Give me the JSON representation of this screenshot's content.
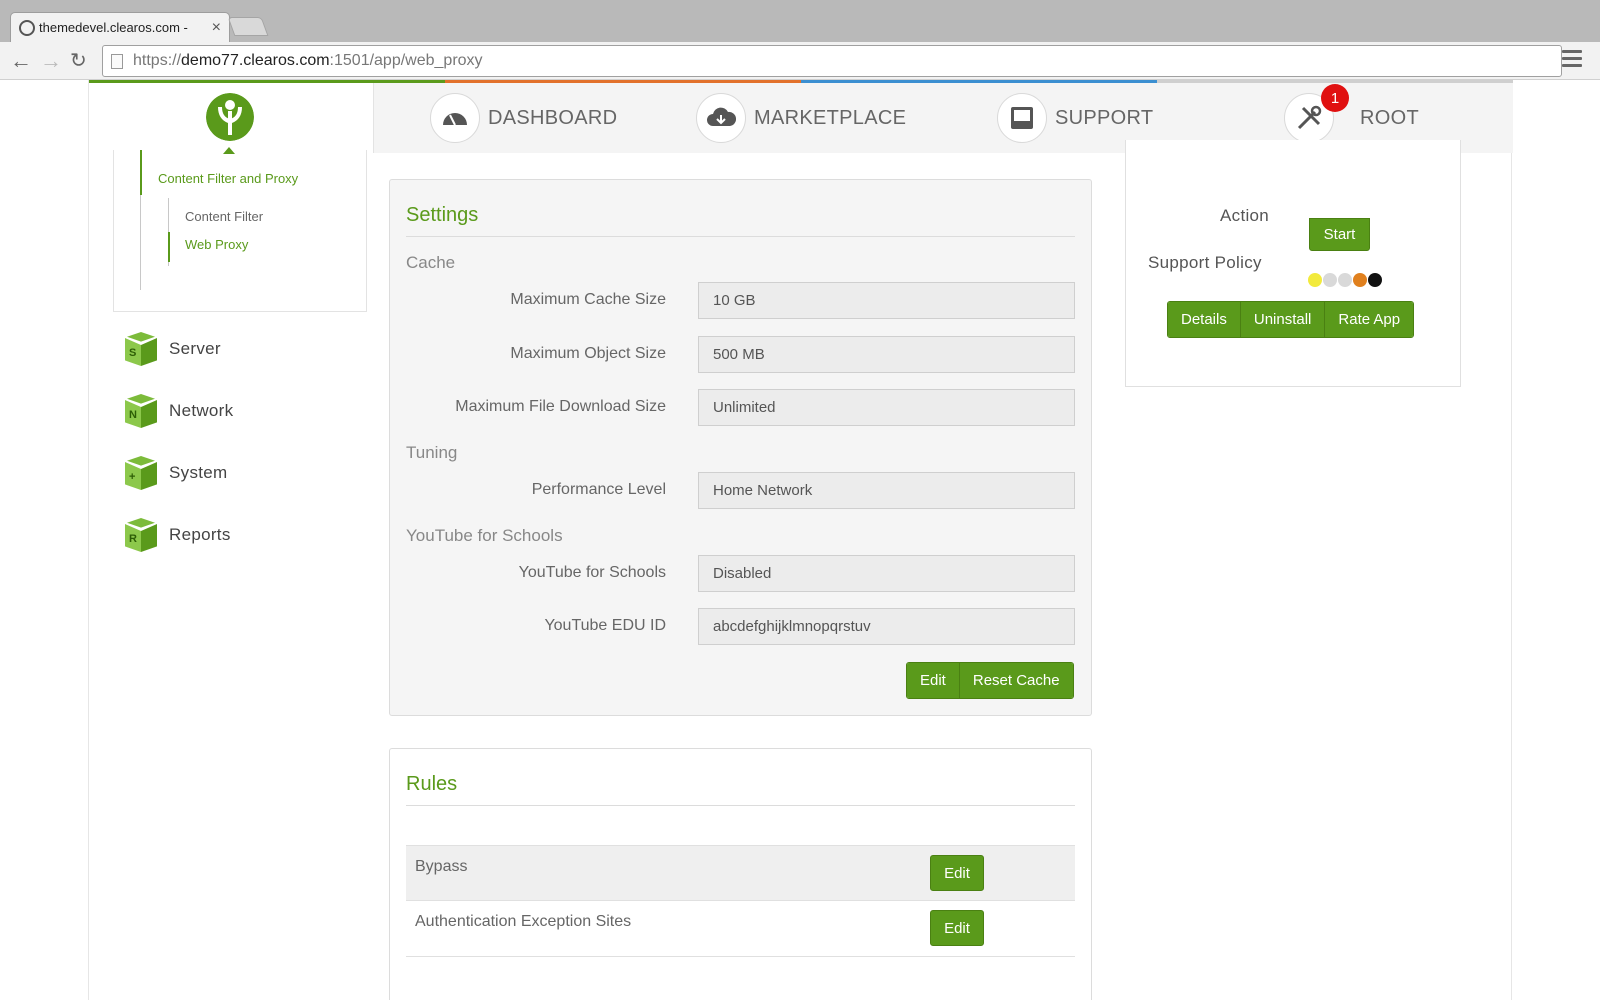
{
  "browser": {
    "tab_title": "themedevel.clearos.com -",
    "url_scheme": "https://",
    "url_host": "demo77.clearos.com",
    "url_rest": ":1501/app/web_proxy"
  },
  "topnav": {
    "dashboard": "DASHBOARD",
    "marketplace": "MARKETPLACE",
    "support": "SUPPORT",
    "root": "ROOT",
    "root_badge": "1"
  },
  "sidebar": {
    "group": "Content Filter and Proxy",
    "sub_items": [
      "Content Filter",
      "Web Proxy"
    ],
    "categories": [
      {
        "label": "Server",
        "letter": "S"
      },
      {
        "label": "Network",
        "letter": "N"
      },
      {
        "label": "System",
        "letter": "+"
      },
      {
        "label": "Reports",
        "letter": "R"
      }
    ]
  },
  "settings": {
    "title": "Settings",
    "cache_heading": "Cache",
    "tuning_heading": "Tuning",
    "youtube_heading": "YouTube for Schools",
    "fields": [
      {
        "label": "Maximum Cache Size",
        "value": "10 GB"
      },
      {
        "label": "Maximum Object Size",
        "value": "500 MB"
      },
      {
        "label": "Maximum File Download Size",
        "value": "Unlimited"
      },
      {
        "label": "Performance Level",
        "value": "Home Network"
      },
      {
        "label": "YouTube for Schools",
        "value": "Disabled"
      },
      {
        "label": "YouTube EDU ID",
        "value": "abcdefghijklmnopqrstuv"
      }
    ],
    "edit_label": "Edit",
    "reset_label": "Reset Cache"
  },
  "rules": {
    "title": "Rules",
    "rows": [
      {
        "name": "Bypass",
        "action": "Edit"
      },
      {
        "name": "Authentication Exception Sites",
        "action": "Edit"
      }
    ]
  },
  "info": {
    "action_label": "Action",
    "start_label": "Start",
    "support_policy_label": "Support Policy",
    "policy_colors": [
      "#f2ea3c",
      "#d9d9d9",
      "#d9d9d9",
      "#e0801e",
      "#111111"
    ],
    "details_label": "Details",
    "uninstall_label": "Uninstall",
    "rate_label": "Rate App"
  },
  "colors": {
    "accent": "#5a9a1b",
    "badge": "#e01010"
  }
}
